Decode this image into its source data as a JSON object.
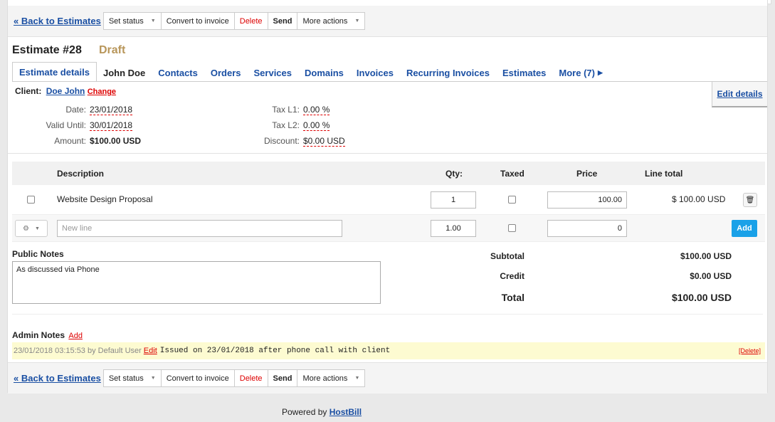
{
  "toolbar": {
    "back": "« Back to Estimates",
    "set_status": "Set status",
    "convert": "Convert to invoice",
    "delete": "Delete",
    "send": "Send",
    "more_actions": "More actions"
  },
  "estimate": {
    "title": "Estimate #28",
    "status": "Draft"
  },
  "tabs": [
    "Estimate details",
    "John Doe",
    "Contacts",
    "Orders",
    "Services",
    "Domains",
    "Invoices",
    "Recurring Invoices",
    "Estimates",
    "More (7)"
  ],
  "details": {
    "client_label": "Client:",
    "client_name": "Doe John",
    "change": "Change",
    "edit_details": "Edit details",
    "date_label": "Date:",
    "date": "23/01/2018",
    "valid_label": "Valid Until:",
    "valid": "30/01/2018",
    "amount_label": "Amount:",
    "amount": "$100.00 USD",
    "tax1_label": "Tax L1:",
    "tax1": "0.00 %",
    "tax2_label": "Tax L2:",
    "tax2": "0.00 %",
    "discount_label": "Discount:",
    "discount": "$0.00 USD"
  },
  "table": {
    "headers": {
      "description": "Description",
      "qty": "Qty:",
      "taxed": "Taxed",
      "price": "Price",
      "line_total": "Line total"
    },
    "items": [
      {
        "description": "Website Design Proposal",
        "qty": "1",
        "taxed": false,
        "price": "100.00",
        "line_total": "$ 100.00 USD"
      }
    ],
    "new_line": {
      "placeholder": "New line",
      "qty": "1.00",
      "price": "0",
      "add": "Add"
    }
  },
  "notes": {
    "public_label": "Public Notes",
    "public_text": "As discussed via Phone",
    "admin_label": "Admin Notes",
    "admin_add": "Add",
    "entry": {
      "meta": "23/01/2018 03:15:53 by Default User",
      "edit": "Edit",
      "text": "Issued on 23/01/2018 after phone call with client",
      "delete": "[Delete]"
    }
  },
  "totals": {
    "subtotal_label": "Subtotal",
    "subtotal": "$100.00 USD",
    "credit_label": "Credit",
    "credit": "$0.00 USD",
    "total_label": "Total",
    "total": "$100.00 USD"
  },
  "footer": {
    "powered": "Powered by",
    "brand": "HostBill"
  },
  "colors": {
    "link": "#1a4fa3",
    "danger": "#d00000",
    "draft": "#b8965a",
    "add_button": "#1aa1e8",
    "note_bg": "#fdfbd1"
  },
  "icons": [
    "caret-down-icon",
    "trash-icon",
    "gear-icon",
    "chevron-right-icon"
  ]
}
